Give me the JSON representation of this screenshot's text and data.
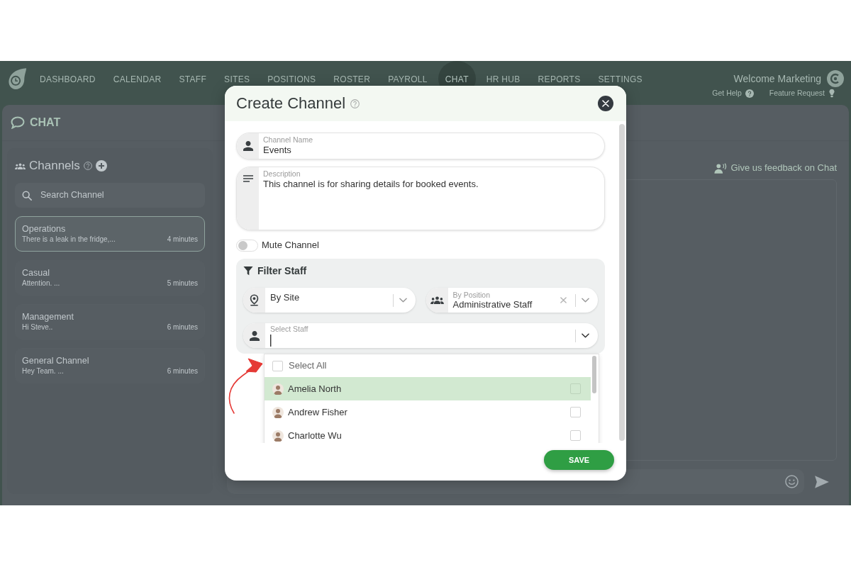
{
  "navbar": {
    "items": [
      {
        "label": "DASHBOARD",
        "selected": false
      },
      {
        "label": "CALENDAR",
        "selected": false
      },
      {
        "label": "STAFF",
        "selected": false
      },
      {
        "label": "SITES",
        "selected": false
      },
      {
        "label": "POSITIONS",
        "selected": false
      },
      {
        "label": "ROSTER",
        "selected": false
      },
      {
        "label": "PAYROLL",
        "selected": false
      },
      {
        "label": "CHAT",
        "selected": true
      },
      {
        "label": "HR HUB",
        "selected": false
      },
      {
        "label": "REPORTS",
        "selected": false
      },
      {
        "label": "SETTINGS",
        "selected": false
      }
    ],
    "welcome": "Welcome Marketing",
    "links": [
      {
        "kind": "help",
        "label": "Get Help"
      },
      {
        "kind": "request",
        "label": "Feature Request"
      }
    ]
  },
  "page": {
    "title": "CHAT"
  },
  "channels_panel": {
    "title": "Channels",
    "search": {
      "placeholder": "Search Channel"
    },
    "channels": [
      {
        "name": "Operations",
        "preview": "There is a leak in the fridge,...",
        "time": "4 minutes",
        "selected": true
      },
      {
        "name": "Casual",
        "preview": "Attention. ...",
        "time": "5 minutes",
        "selected": false
      },
      {
        "name": "Management",
        "preview": "Hi Steve..",
        "time": "6 minutes",
        "selected": false
      },
      {
        "name": "General Channel",
        "preview": "Hey Team. ...",
        "time": "6 minutes",
        "selected": false
      }
    ]
  },
  "chat_panel": {
    "feedback_link": "Give us feedback on Chat"
  },
  "modal": {
    "title": "Create Channel",
    "channel_name": {
      "label": "Channel Name",
      "value": "Events"
    },
    "description": {
      "label": "Description",
      "value": "This channel is for sharing details for booked events."
    },
    "mute": {
      "label": "Mute Channel",
      "on": false
    },
    "filter": {
      "title": "Filter Staff",
      "site": {
        "label": "By Site"
      },
      "position": {
        "label": "By Position",
        "value": "Administrative Staff"
      },
      "staff": {
        "label": "Select Staff",
        "focused": true
      }
    },
    "staff_menu": {
      "select_all": {
        "label": "Select All",
        "checked": false
      },
      "options": [
        {
          "name": "Amelia North",
          "highlighted": true,
          "checked": false
        },
        {
          "name": "Andrew Fisher",
          "highlighted": false,
          "checked": false
        },
        {
          "name": "Charlotte Wu",
          "highlighted": false,
          "checked": false
        }
      ]
    },
    "save_button": "SAVE"
  }
}
